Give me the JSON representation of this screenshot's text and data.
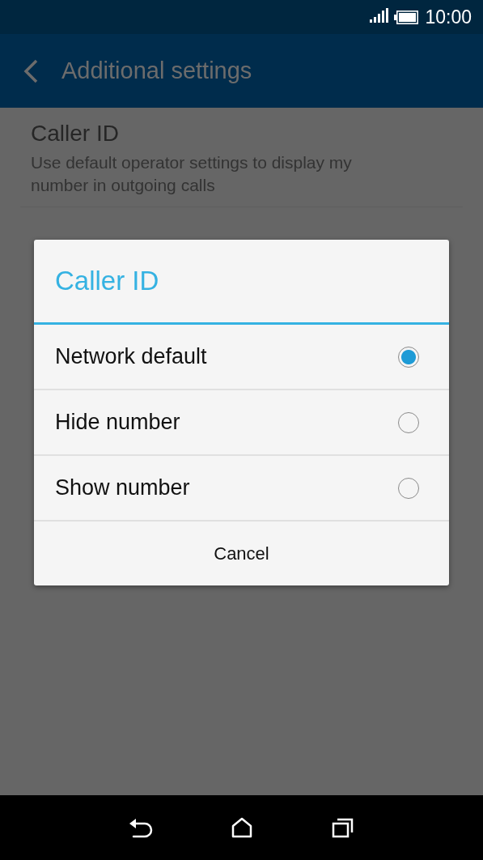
{
  "status_bar": {
    "time": "10:00"
  },
  "app_bar": {
    "title": "Additional settings"
  },
  "settings": [
    {
      "title": "Caller ID",
      "summary": "Use default operator settings to display my number in outgoing calls"
    }
  ],
  "dialog": {
    "title": "Caller ID",
    "options": [
      {
        "label": "Network default",
        "selected": true
      },
      {
        "label": "Hide number",
        "selected": false
      },
      {
        "label": "Show number",
        "selected": false
      }
    ],
    "button": "Cancel"
  }
}
